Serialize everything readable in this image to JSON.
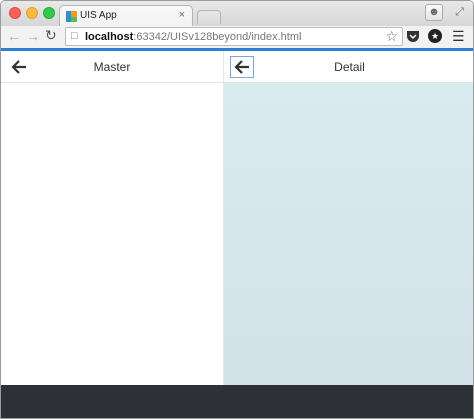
{
  "browser": {
    "tab_title": "UIS App",
    "tab_close": "×",
    "url_host": "localhost",
    "url_rest": ":63342/UISv128beyond/index.html"
  },
  "icons": {
    "back_nav": "back-icon",
    "forward_nav": "forward-icon",
    "reload": "reload-icon",
    "star": "star-icon",
    "menu": "hamburger-menu-icon",
    "profile": "person-icon"
  },
  "master": {
    "title": "Master"
  },
  "detail": {
    "title": "Detail"
  },
  "colors": {
    "accent": "#2b7fd4",
    "detail_bg": "#d9ecef",
    "footer": "#2d3136"
  }
}
